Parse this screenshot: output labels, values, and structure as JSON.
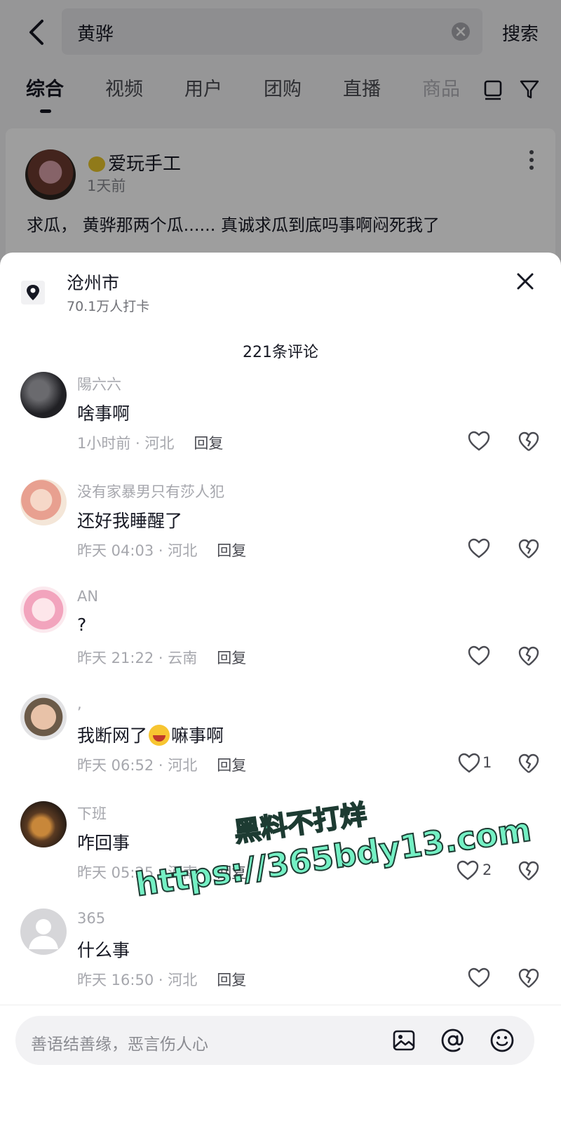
{
  "search": {
    "query": "黄骅",
    "button": "搜索"
  },
  "tabs": [
    "综合",
    "视频",
    "用户",
    "团购",
    "直播",
    "商品"
  ],
  "post": {
    "author": "爱玩手工",
    "time": "1天前",
    "text": "求瓜， 黄骅那两个瓜...... 真诚求瓜到底吗事啊闷死我了"
  },
  "location": {
    "name": "沧州市",
    "checkins": "70.1万人打卡"
  },
  "comment_count": "221条评论",
  "comments": [
    {
      "user": "陽六六",
      "text": "啥事啊",
      "meta": "1小时前 · 河北",
      "reply": "回复",
      "likes": ""
    },
    {
      "user": "没有家暴男只有莎人犯",
      "text": "还好我睡醒了",
      "meta": "昨天 04:03 · 河北",
      "reply": "回复",
      "likes": ""
    },
    {
      "user": "AN",
      "text": "?",
      "meta": "昨天 21:22 · 云南",
      "reply": "回复",
      "likes": ""
    },
    {
      "user": ",",
      "text_before": "我断网了",
      "text_after": "嘛事啊",
      "meta": "昨天 06:52 · 河北",
      "reply": "回复",
      "likes": "1"
    },
    {
      "user": "下班",
      "text": "咋回事",
      "meta": "昨天 05:25 · 河南",
      "reply": "回复",
      "likes": "2"
    },
    {
      "user": "365",
      "text": "什么事",
      "meta": "昨天 16:50 · 河北",
      "reply": "回复",
      "likes": ""
    }
  ],
  "watermark": {
    "line1": "黑料不打烊",
    "line2": "https://365bdy13.com"
  },
  "input": {
    "placeholder": "善语结善缘，恶言伤人心"
  },
  "colors": {
    "accent_watermark": "#74f0c4",
    "text_primary": "#161823",
    "text_secondary": "#a6a7ad"
  }
}
